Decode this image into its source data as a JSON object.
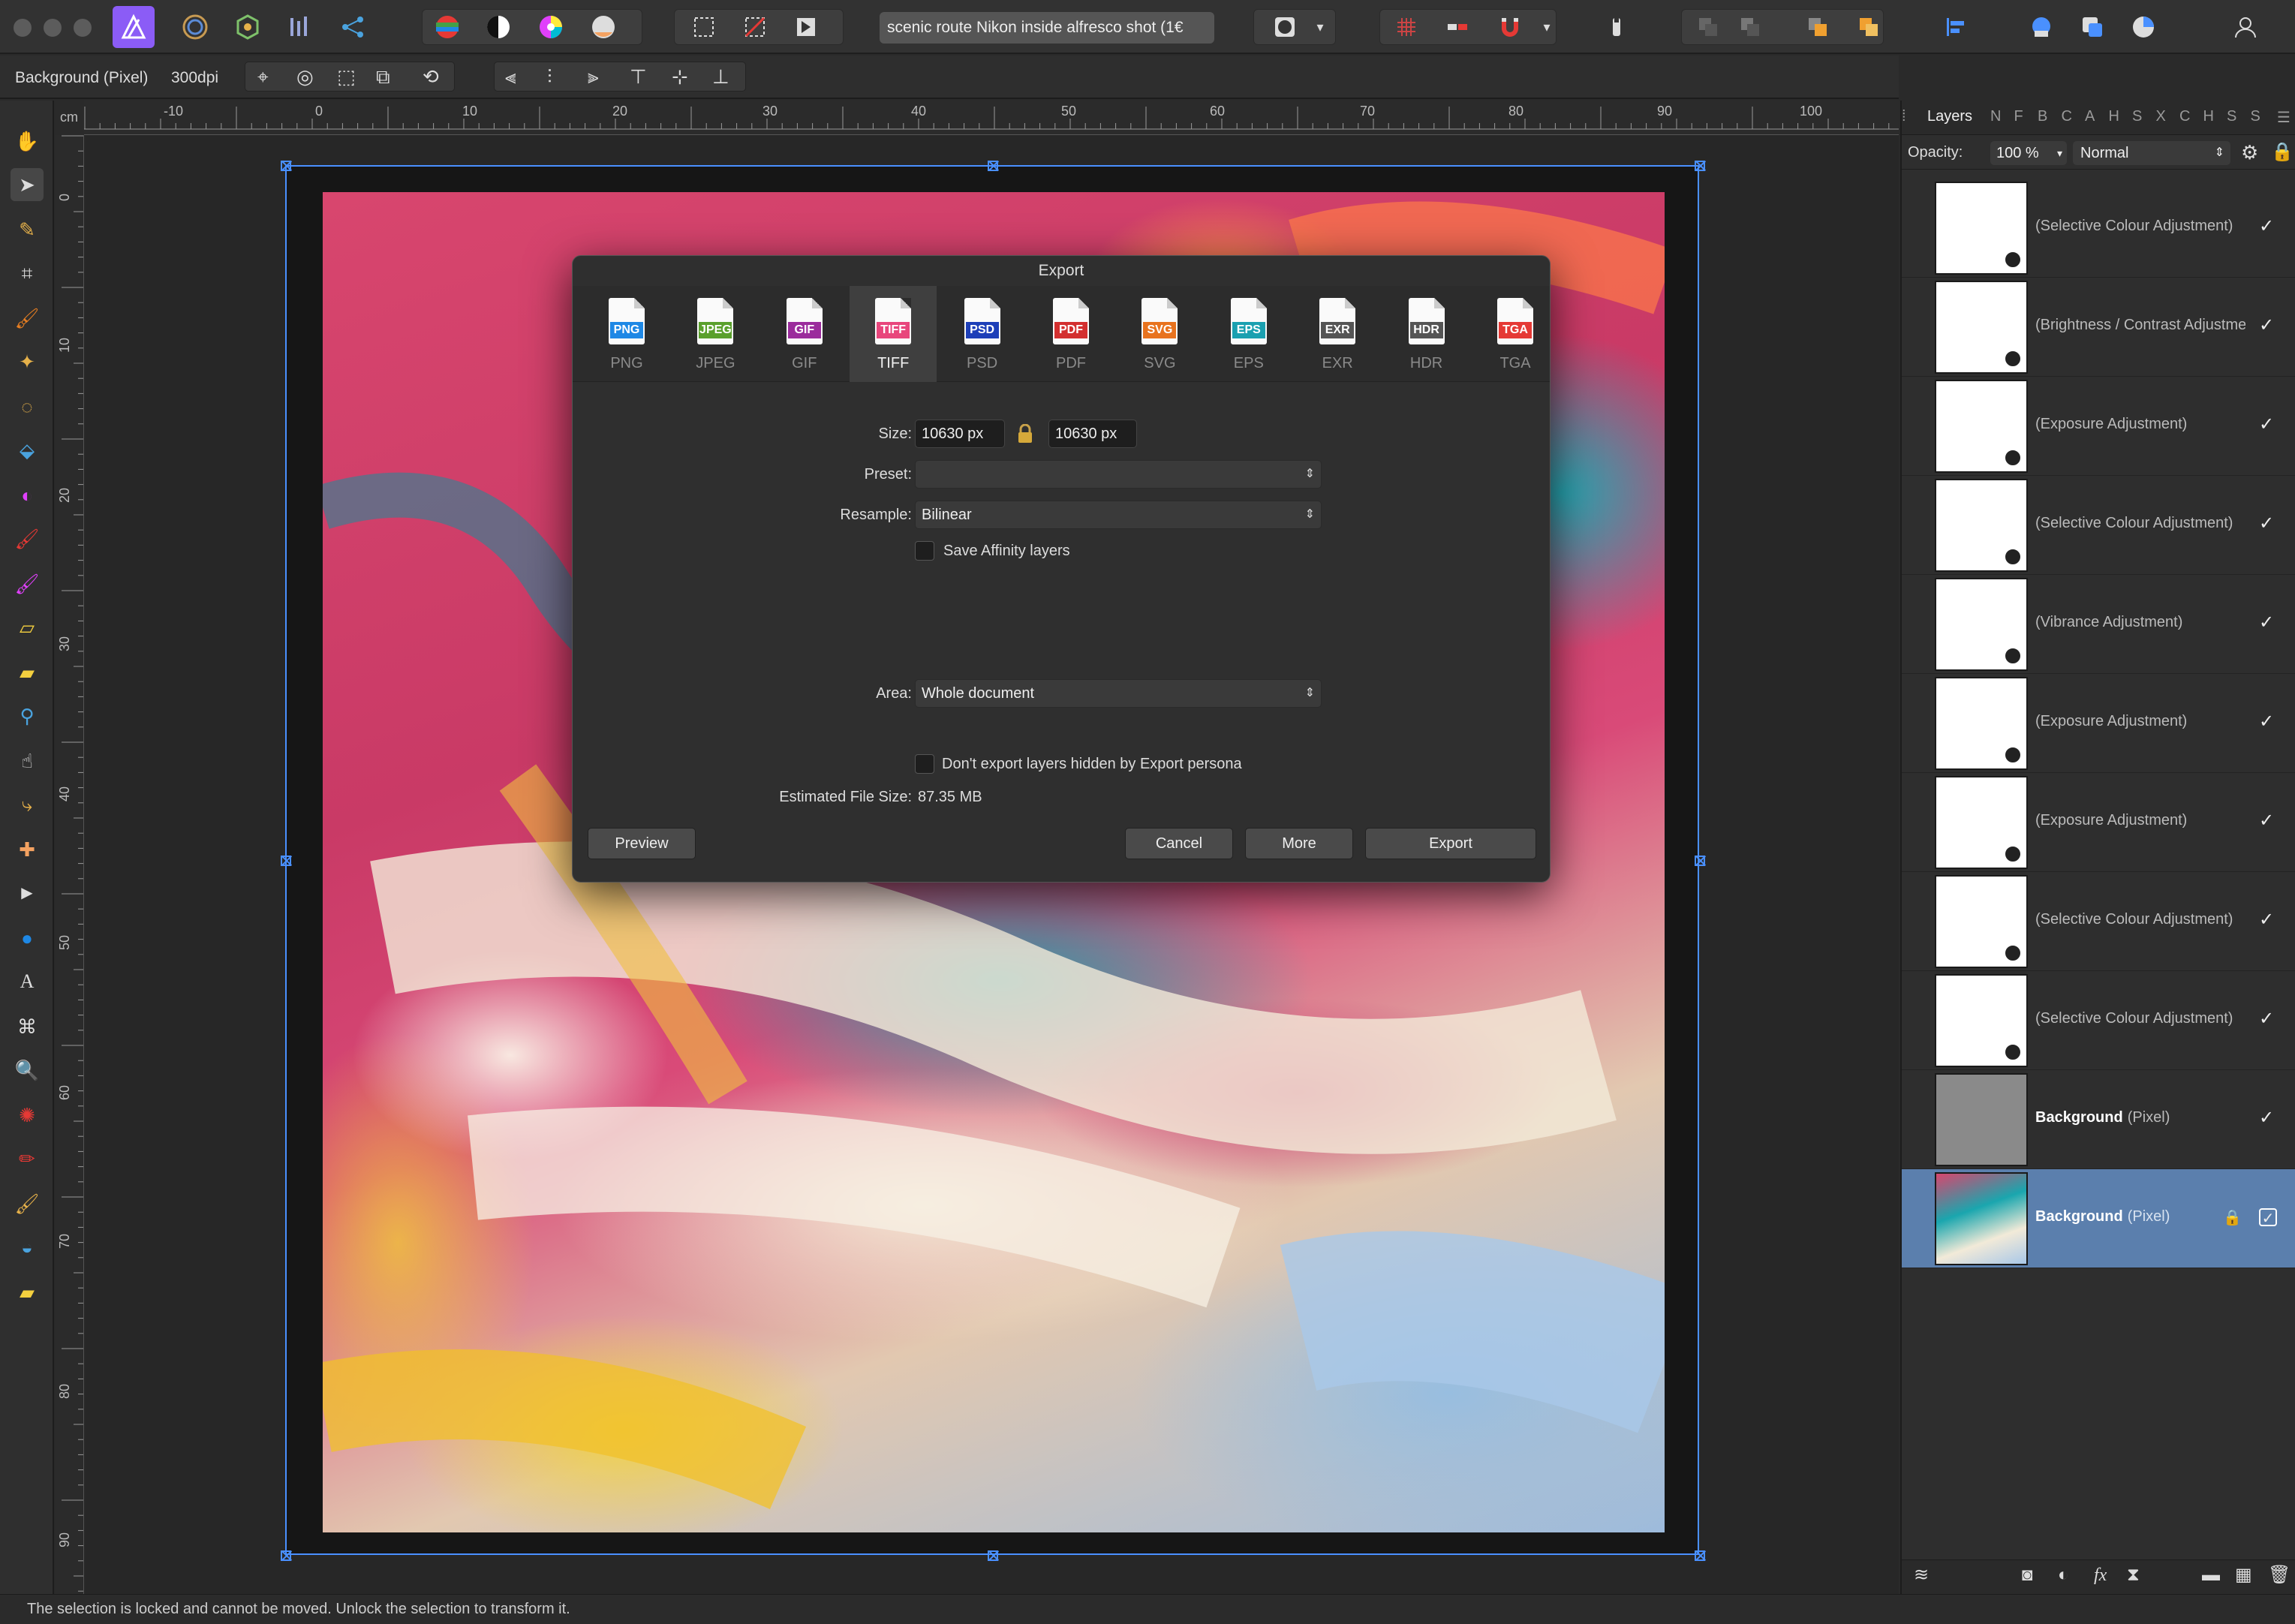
{
  "window": {
    "document_title": "scenic route Nikon inside alfresco shot (1€",
    "colors": {
      "accent": "#4a90ff",
      "selection_bg": "#5b7fad",
      "app_purple": "#8b5cf6"
    }
  },
  "toolbar": {
    "icons": [
      "affinity-photo-icon",
      "liquify-persona-icon",
      "develop-persona-icon",
      "tone-mapping-persona-icon",
      "export-persona-icon",
      "levels-icon",
      "black-white-icon",
      "color-wheel-icon",
      "white-balance-icon",
      "marquee-icon",
      "no-selection-icon",
      "quick-mask-icon",
      "brush-mode-icon",
      "grid-icon",
      "snapping-icon",
      "magnet-icon",
      "assistant-icon",
      "arrange-icon",
      "align-icon",
      "view-icon",
      "mask-icon",
      "user-icon"
    ]
  },
  "context": {
    "layer_label": "Background (Pixel)",
    "dpi_label": "300dpi"
  },
  "ruler": {
    "unit": "cm",
    "top_ticks": [
      "-10",
      "0",
      "10",
      "20",
      "30",
      "40",
      "50",
      "60",
      "70",
      "80",
      "90",
      "100"
    ],
    "left_ticks": [
      "0",
      "10",
      "20",
      "30",
      "40",
      "50",
      "60",
      "70",
      "80",
      "90"
    ]
  },
  "dialog": {
    "title": "Export",
    "formats": [
      {
        "tag": "PNG",
        "label": "PNG",
        "color": "#1e88e5"
      },
      {
        "tag": "JPEG",
        "label": "JPEG",
        "color": "#5aa02c"
      },
      {
        "tag": "GIF",
        "label": "GIF",
        "color": "#9b2c9c"
      },
      {
        "tag": "TIFF",
        "label": "TIFF",
        "color": "#e8467c"
      },
      {
        "tag": "PSD",
        "label": "PSD",
        "color": "#1d3fb8"
      },
      {
        "tag": "PDF",
        "label": "PDF",
        "color": "#d32f2f"
      },
      {
        "tag": "SVG",
        "label": "SVG",
        "color": "#e8731e"
      },
      {
        "tag": "EPS",
        "label": "EPS",
        "color": "#1aa0b0"
      },
      {
        "tag": "EXR",
        "label": "EXR",
        "color": "#555555"
      },
      {
        "tag": "HDR",
        "label": "HDR",
        "color": "#555555"
      },
      {
        "tag": "TGA",
        "label": "TGA",
        "color": "#e53935"
      }
    ],
    "selected_format": "TIFF",
    "size_label": "Size:",
    "width_value": "10630 px",
    "height_value": "10630 px",
    "preset_label": "Preset:",
    "preset_value": "",
    "resample_label": "Resample:",
    "resample_value": "Bilinear",
    "save_layers_label": "Save Affinity layers",
    "area_label": "Area:",
    "area_value": "Whole document",
    "hidden_layers_label": "Don't export layers hidden by Export persona",
    "file_size_label": "Estimated File Size:",
    "file_size_value": "87.35 MB",
    "preview_button": "Preview",
    "cancel_button": "Cancel",
    "more_button": "More",
    "export_button": "Export"
  },
  "panel": {
    "tabs": [
      "Layers",
      "N",
      "F",
      "B",
      "C",
      "A",
      "H",
      "S",
      "X",
      "C",
      "H",
      "S",
      "S"
    ],
    "active_tab": "Layers",
    "opacity_label": "Opacity:",
    "opacity_value": "100 %",
    "blend_mode": "Normal",
    "layers": [
      {
        "name": "(Selective Colour Adjustment)",
        "bold": "",
        "kind": ""
      },
      {
        "name": "(Brightness / Contrast Adjustment)",
        "bold": "",
        "kind": ""
      },
      {
        "name": "(Exposure Adjustment)",
        "bold": "",
        "kind": ""
      },
      {
        "name": "(Selective Colour Adjustment)",
        "bold": "",
        "kind": ""
      },
      {
        "name": "(Vibrance Adjustment)",
        "bold": "",
        "kind": ""
      },
      {
        "name": "(Exposure Adjustment)",
        "bold": "",
        "kind": ""
      },
      {
        "name": "(Exposure Adjustment)",
        "bold": "",
        "kind": ""
      },
      {
        "name": "(Selective Colour Adjustment)",
        "bold": "",
        "kind": ""
      },
      {
        "name": "(Selective Colour Adjustment)",
        "bold": "",
        "kind": ""
      },
      {
        "name": "",
        "bold": "Background",
        "kind": "(Pixel)"
      },
      {
        "name": "",
        "bold": "Background",
        "kind": "(Pixel)"
      }
    ]
  },
  "status": {
    "message": "The selection is locked and cannot be moved. Unlock the selection to transform it."
  }
}
